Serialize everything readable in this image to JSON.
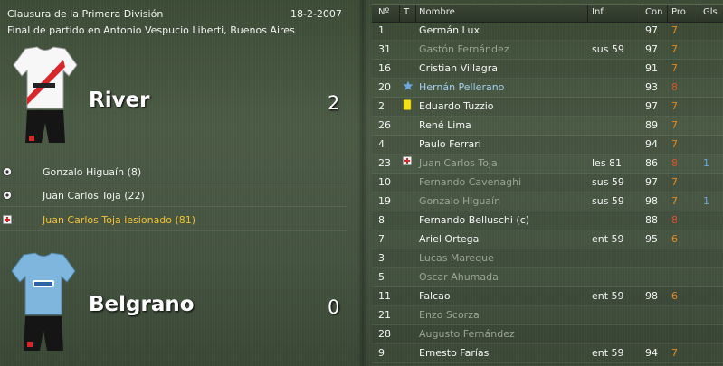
{
  "header": {
    "competition": "Clausura de la Primera División",
    "date": "18-2-2007",
    "venue": "Final de partido en Antonio Vespucio Liberti, Buenos Aires"
  },
  "home": {
    "name": "River",
    "score": "2",
    "kit_colors": {
      "shirt": "#ffffff",
      "sash": "#d8262a",
      "shorts": "#111111"
    }
  },
  "away": {
    "name": "Belgrano",
    "score": "0",
    "kit_colors": {
      "shirt": "#7fb6dd",
      "shorts": "#111111"
    }
  },
  "events": [
    {
      "icon": "ball-icon",
      "text": "Gonzalo Higuaín (8)"
    },
    {
      "icon": "ball-icon",
      "text": "Juan Carlos Toja (22)"
    },
    {
      "icon": "injury-icon",
      "text": "Juan Carlos Toja lesionado (81)"
    }
  ],
  "table": {
    "headers": {
      "num": "Nº",
      "t": "T",
      "name": "Nombre",
      "inf": "Inf.",
      "con": "Con",
      "pro": "Pro",
      "gls": "Gls"
    },
    "rows": [
      {
        "num": "1",
        "t": "",
        "name": "Germán Lux",
        "inf": "",
        "con": "97",
        "pro": "7",
        "gls": "",
        "sub": false
      },
      {
        "num": "31",
        "t": "",
        "name": "Gastón Fernández",
        "inf": "sus 59",
        "con": "97",
        "pro": "7",
        "gls": "",
        "sub": true
      },
      {
        "num": "16",
        "t": "",
        "name": "Cristian Villagra",
        "inf": "",
        "con": "91",
        "pro": "7",
        "gls": "",
        "sub": false
      },
      {
        "num": "20",
        "t": "star-icon",
        "name": "Hernán Pellerano",
        "inf": "",
        "con": "93",
        "pro": "8",
        "gls": "",
        "sub": false,
        "star": true
      },
      {
        "num": "2",
        "t": "yellow-card-icon",
        "name": "Eduardo Tuzzio",
        "inf": "",
        "con": "97",
        "pro": "7",
        "gls": "",
        "sub": false
      },
      {
        "num": "26",
        "t": "",
        "name": "René Lima",
        "inf": "",
        "con": "89",
        "pro": "7",
        "gls": "",
        "sub": false
      },
      {
        "num": "4",
        "t": "",
        "name": "Paulo Ferrari",
        "inf": "",
        "con": "94",
        "pro": "7",
        "gls": "",
        "sub": false
      },
      {
        "num": "23",
        "t": "injury-icon",
        "name": "Juan Carlos Toja",
        "inf": "les 81",
        "con": "86",
        "pro": "8",
        "gls": "1",
        "sub": true
      },
      {
        "num": "10",
        "t": "",
        "name": "Fernando Cavenaghi",
        "inf": "sus 59",
        "con": "97",
        "pro": "7",
        "gls": "",
        "sub": true
      },
      {
        "num": "19",
        "t": "",
        "name": "Gonzalo Higuaín",
        "inf": "sus 59",
        "con": "98",
        "pro": "7",
        "gls": "1",
        "sub": true
      },
      {
        "num": "8",
        "t": "",
        "name": "Fernando Belluschi (c)",
        "inf": "",
        "con": "88",
        "pro": "8",
        "gls": "",
        "sub": false
      },
      {
        "num": "7",
        "t": "",
        "name": "Ariel Ortega",
        "inf": "ent 59",
        "con": "95",
        "pro": "6",
        "gls": "",
        "sub": false
      },
      {
        "num": "3",
        "t": "",
        "name": "Lucas Mareque",
        "inf": "",
        "con": "",
        "pro": "",
        "gls": "",
        "sub": true
      },
      {
        "num": "5",
        "t": "",
        "name": "Oscar Ahumada",
        "inf": "",
        "con": "",
        "pro": "",
        "gls": "",
        "sub": true
      },
      {
        "num": "11",
        "t": "",
        "name": "Falcao",
        "inf": "ent 59",
        "con": "98",
        "pro": "6",
        "gls": "",
        "sub": false
      },
      {
        "num": "21",
        "t": "",
        "name": "Enzo Scorza",
        "inf": "",
        "con": "",
        "pro": "",
        "gls": "",
        "sub": true
      },
      {
        "num": "28",
        "t": "",
        "name": "Augusto Fernández",
        "inf": "",
        "con": "",
        "pro": "",
        "gls": "",
        "sub": true
      },
      {
        "num": "9",
        "t": "",
        "name": "Ernesto Farías",
        "inf": "ent 59",
        "con": "94",
        "pro": "7",
        "gls": "",
        "sub": false
      }
    ]
  }
}
